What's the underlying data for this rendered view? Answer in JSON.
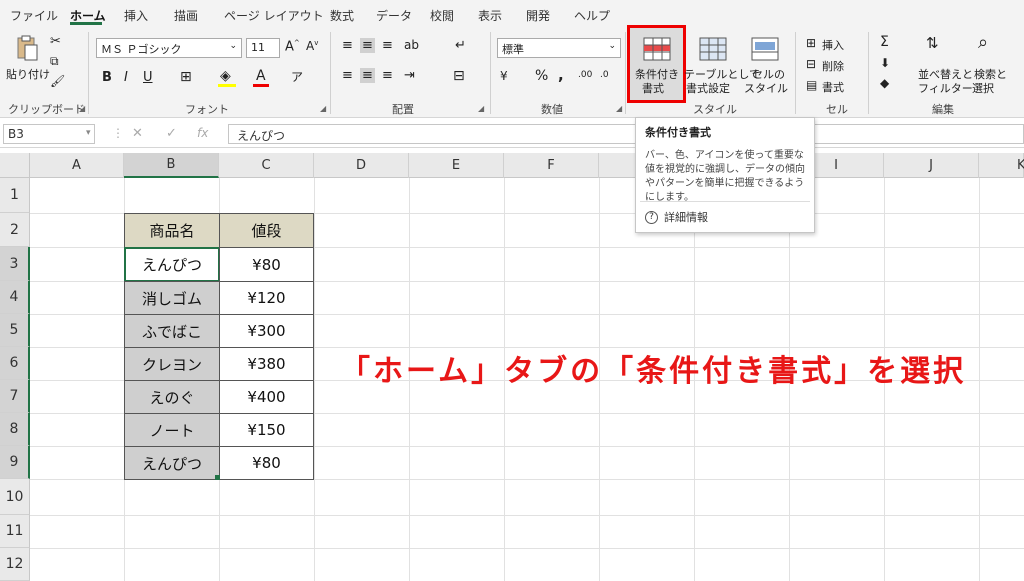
{
  "tabs": [
    "ファイル",
    "ホーム",
    "挿入",
    "描画",
    "ページ レイアウト",
    "数式",
    "データ",
    "校閲",
    "表示",
    "開発",
    "ヘルプ"
  ],
  "ribbon": {
    "clipboard": {
      "paste": "貼り付け",
      "group": "クリップボード"
    },
    "font": {
      "name": "ＭＳ Ｐゴシック",
      "size": "11",
      "group": "フォント"
    },
    "alignment": {
      "group": "配置"
    },
    "number": {
      "format": "標準",
      "group": "数値"
    },
    "styles": {
      "conditional": "条件付き書式",
      "conditional_line1": "条件付き",
      "conditional_line2": "書式",
      "table_line1": "テーブルとして",
      "table_line2": "書式設定",
      "cell_line1": "セルの",
      "cell_line2": "スタイル",
      "group": "スタイル"
    },
    "cells": {
      "insert": "挿入",
      "delete": "削除",
      "format": "書式",
      "group": "セル"
    },
    "editing": {
      "sort_line1": "並べ替えと",
      "sort_line2": "フィルター",
      "find_line1": "検索と",
      "find_line2": "選択",
      "group": "編集"
    }
  },
  "formula_bar": {
    "name_box": "B3",
    "content": "えんぴつ",
    "fx": "fx"
  },
  "columns": [
    "A",
    "B",
    "C",
    "D",
    "E",
    "F",
    "G",
    "H",
    "I",
    "J",
    "K"
  ],
  "rows": [
    "1",
    "2",
    "3",
    "4",
    "5",
    "6",
    "7",
    "8",
    "9",
    "10",
    "11",
    "12"
  ],
  "table": {
    "headers": [
      "商品名",
      "値段"
    ],
    "rows": [
      [
        "えんぴつ",
        "¥80"
      ],
      [
        "消しゴム",
        "¥120"
      ],
      [
        "ふでばこ",
        "¥300"
      ],
      [
        "クレヨン",
        "¥380"
      ],
      [
        "えのぐ",
        "¥400"
      ],
      [
        "ノート",
        "¥150"
      ],
      [
        "えんぴつ",
        "¥80"
      ]
    ]
  },
  "tooltip": {
    "title": "条件付き書式",
    "body": "バー、色、アイコンを使って重要な値を視覚的に強調し、データの傾向やパターンを簡単に把握できるようにします。",
    "help": "詳細情報"
  },
  "annotation": "「ホーム」タブの「条件付き書式」を選択",
  "colors": {
    "accent": "#217346",
    "highlight": "#e81717",
    "header_fill": "#ddd9c4",
    "gray_fill": "#cfcfcf"
  }
}
